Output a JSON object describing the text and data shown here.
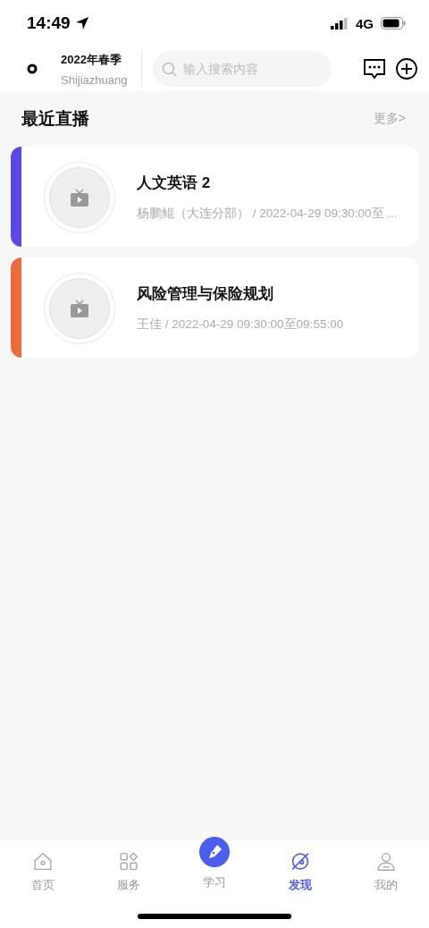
{
  "status_bar": {
    "time": "14:49",
    "network": "4G"
  },
  "header": {
    "term": "2022年春季",
    "location": "Shijiazhuang",
    "search": {
      "placeholder": "输入搜索内容"
    }
  },
  "section": {
    "title": "最近直播",
    "more": "更多>"
  },
  "lives": [
    {
      "title": "人文英语 2",
      "meta": "杨鹏鲲（大连分部） / 2022-04-29 09:30:00至 ...",
      "color": "#5b46e6"
    },
    {
      "title": "风险管理与保险规划",
      "meta": "王佳 / 2022-04-29 09:30:00至09:55:00",
      "color": "#ec6a3c"
    }
  ],
  "tabs": [
    {
      "label": "首页",
      "kind": "home",
      "selected": false
    },
    {
      "label": "服务",
      "kind": "grid",
      "selected": false
    },
    {
      "label": "学习",
      "kind": "raised",
      "selected": false
    },
    {
      "label": "发现",
      "kind": "discover",
      "selected": true
    },
    {
      "label": "我的",
      "kind": "user",
      "selected": false
    }
  ]
}
